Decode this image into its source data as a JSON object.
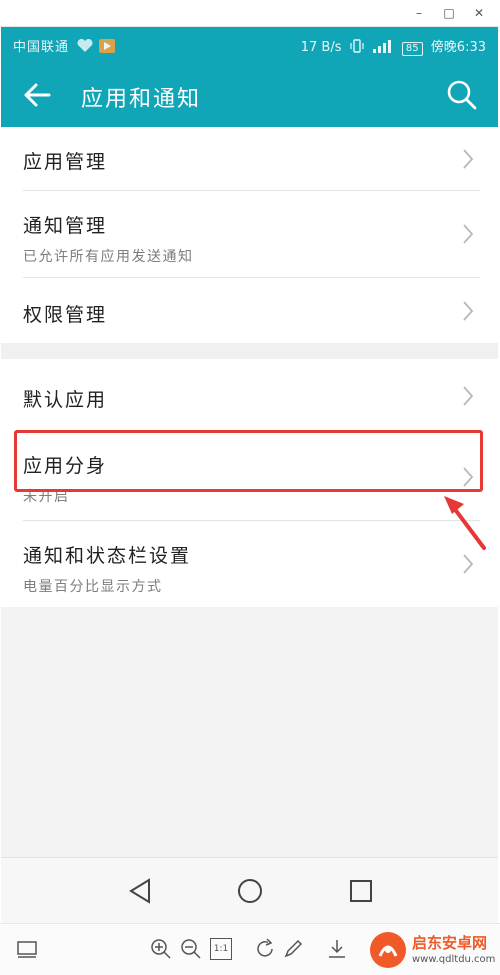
{
  "status": {
    "carrier": "中国联通",
    "speed": "17 B/s",
    "battery": "85",
    "time": "傍晚6:33"
  },
  "header": {
    "title": "应用和通知"
  },
  "groups": [
    {
      "items": [
        {
          "title": "应用管理",
          "subtitle": ""
        },
        {
          "title": "通知管理",
          "subtitle": "已允许所有应用发送通知"
        },
        {
          "title": "权限管理",
          "subtitle": ""
        }
      ]
    },
    {
      "items": [
        {
          "title": "默认应用",
          "subtitle": ""
        },
        {
          "title": "应用分身",
          "subtitle": "未开启"
        },
        {
          "title": "通知和状态栏设置",
          "subtitle": "电量百分比显示方式"
        }
      ]
    }
  ],
  "toolbar": {
    "zoom_reset_label": "1:1"
  },
  "colors": {
    "accent": "#10a6b8",
    "highlight": "#e53935"
  }
}
